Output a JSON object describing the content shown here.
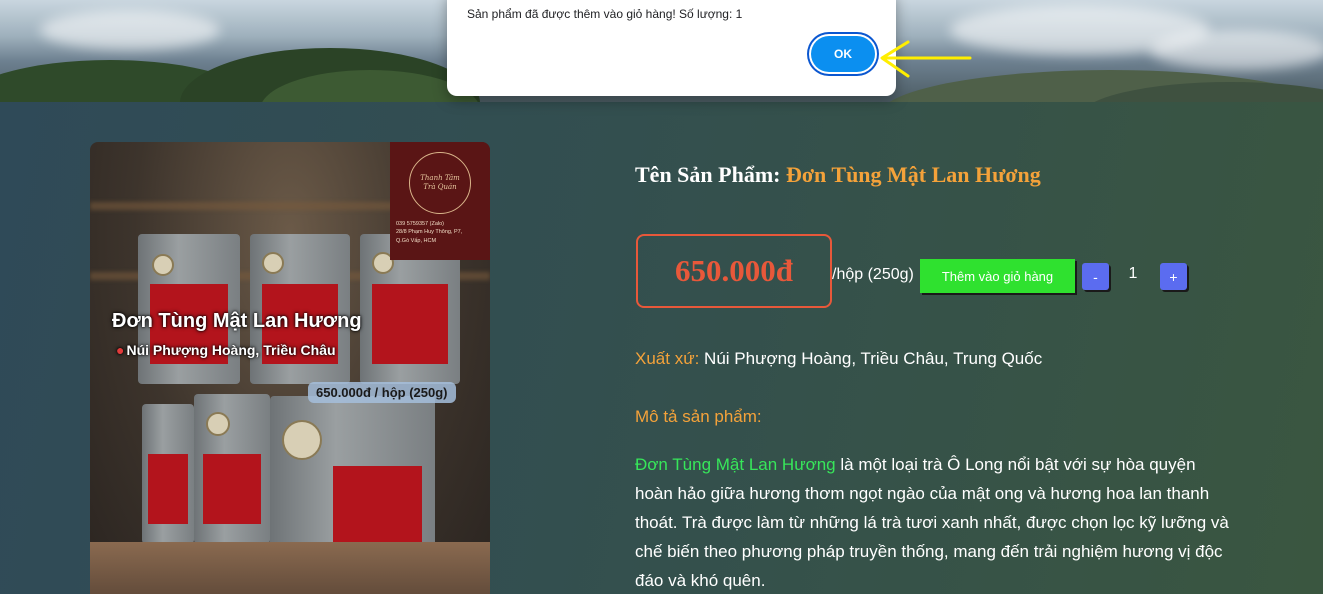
{
  "dialog": {
    "message": "Sản phẩm đã được thêm vào giỏ hàng! Số lượng: 1",
    "ok_label": "OK"
  },
  "product_image": {
    "title": "Đơn Tùng Mật Lan Hương",
    "location": "Núi Phượng Hoàng, Triều Châu",
    "price_tag": "650.000đ / hộp (250g)",
    "logo": {
      "name_line1": "Thanh Tâm",
      "name_line2": "Trà Quán",
      "phone": "039 5759357 (Zalo)",
      "address_line1": "28/8 Phạm Huy Thông, P7,",
      "address_line2": "Q.Gò Vấp, HCM"
    }
  },
  "product": {
    "name_label": "Tên Sản Phẩm:",
    "name": "Đơn Tùng Mật Lan Hương",
    "price": "650.000đ",
    "unit": "/hộp (250g)",
    "add_to_cart_label": "Thêm vào giỏ hàng",
    "qty_minus": "-",
    "quantity": "1",
    "qty_plus": "+",
    "origin_label": "Xuất xứ:",
    "origin_value": "Núi Phượng Hoàng, Triều Châu, Trung Quốc",
    "description_heading": "Mô tả sản phẩm:",
    "description_highlight": "Đơn Tùng Mật Lan Hương",
    "description_text": " là một loại trà Ô Long nổi bật với sự hòa quyện hoàn hảo giữa hương thơm ngọt ngào của mật ong và hương hoa lan thanh thoát. Trà được làm từ những lá trà tươi xanh nhất, được chọn lọc kỹ lưỡng và chế biến theo phương pháp truyền thống, mang đến trải nghiệm hương vị độc đáo và khó quên."
  },
  "colors": {
    "accent_orange": "#f4a23a",
    "price_red": "#e8583a",
    "cart_green": "#2fe12f",
    "qty_blue": "#5b6cf0",
    "highlight_green": "#37e65a",
    "ok_blue": "#0b8ff0",
    "annotation_arrow": "#ffee00"
  },
  "icons": {
    "location": "pin-icon",
    "annotation": "arrow-pointer-icon"
  }
}
